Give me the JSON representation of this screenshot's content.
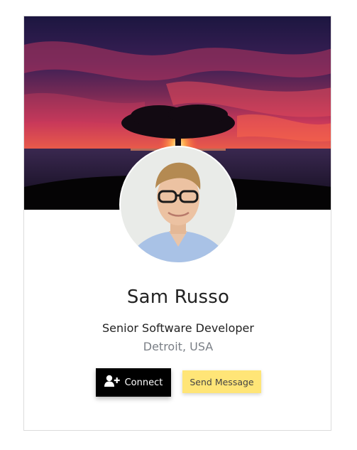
{
  "profile": {
    "name": "Sam Russo",
    "title": "Senior Software Developer",
    "location": "Detroit, USA"
  },
  "actions": {
    "connect_label": "Connect",
    "connect_icon": "user-plus-icon",
    "message_label": "Send Message"
  },
  "colors": {
    "connect_bg": "#000000",
    "message_bg": "#ffe577",
    "location_text": "#7a7f86"
  }
}
